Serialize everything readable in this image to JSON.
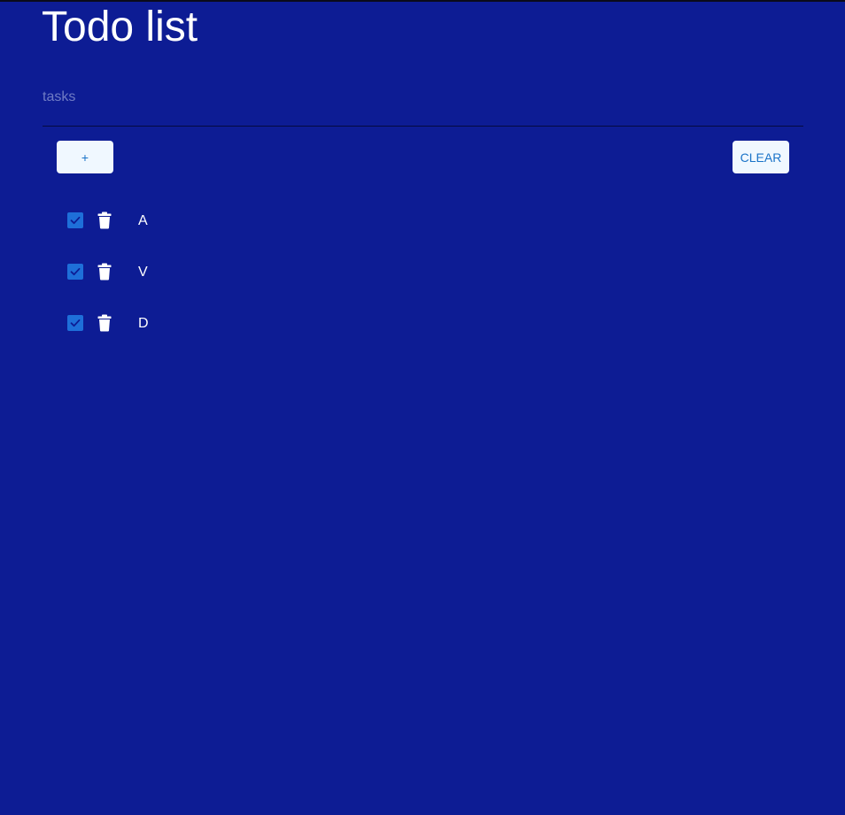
{
  "app": {
    "title": "Todo list"
  },
  "input": {
    "placeholder": "tasks",
    "value": ""
  },
  "buttons": {
    "add_label": "+",
    "clear_label": "CLEAR"
  },
  "tasks": [
    {
      "label": "A",
      "checked": true
    },
    {
      "label": "V",
      "checked": true
    },
    {
      "label": "D",
      "checked": true
    }
  ],
  "icons": {
    "checkbox": "check-icon",
    "delete": "trash-icon"
  },
  "colors": {
    "background": "#0d1c94",
    "button_bg": "#f0f8ff",
    "button_text": "#1a73c8",
    "checkbox": "#1e6fd9",
    "text": "#ffffff"
  }
}
